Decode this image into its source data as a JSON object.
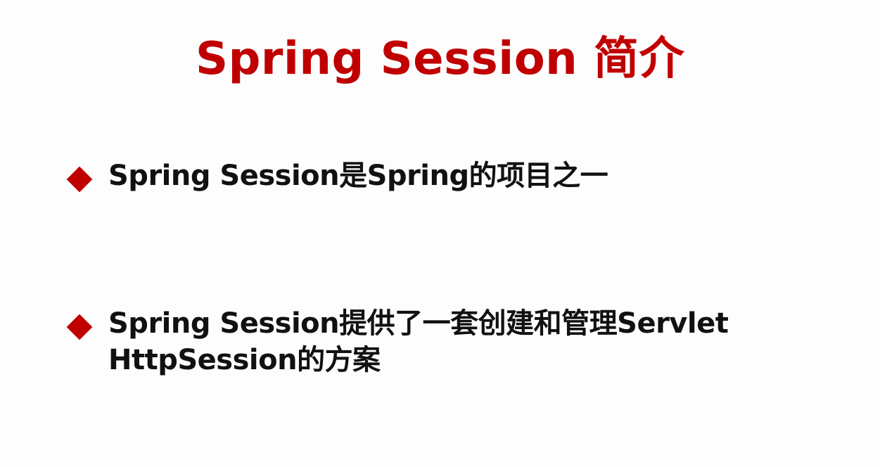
{
  "slide": {
    "title": "Spring Session 简介",
    "bullets": [
      {
        "text": "Spring Session是Spring的项目之一"
      },
      {
        "text": "Spring Session提供了一套创建和管理Servlet HttpSession的方案"
      }
    ]
  },
  "colors": {
    "accent": "#c00000",
    "text": "#111111",
    "background": "#fdfdfd"
  },
  "icons": {
    "bullet_marker": "diamond-icon"
  }
}
